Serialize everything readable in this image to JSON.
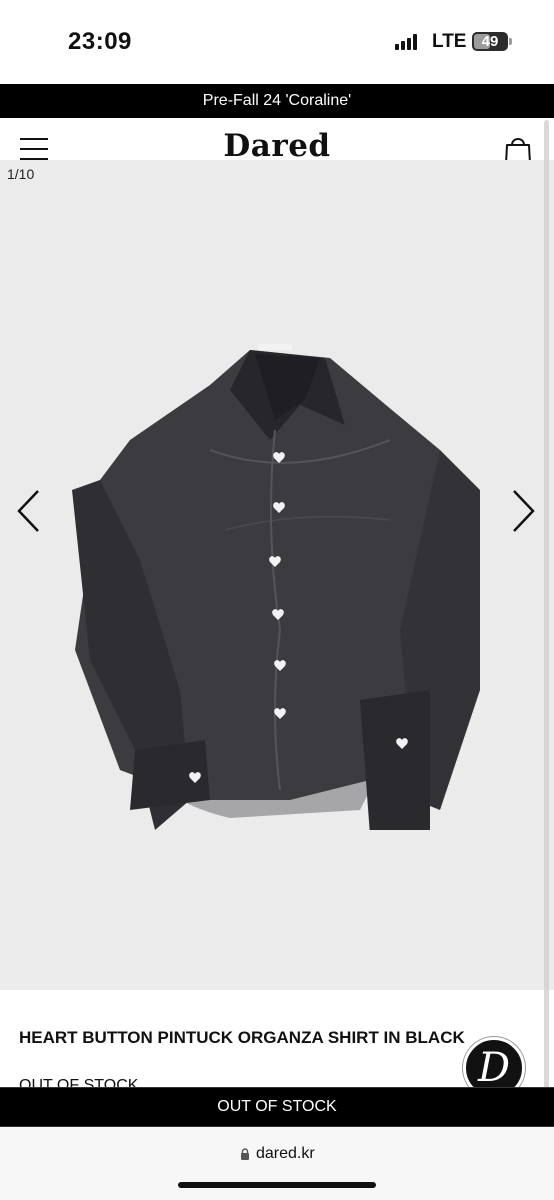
{
  "status_bar": {
    "time": "23:09",
    "network": "LTE",
    "battery": "49",
    "battery_level": 0.49
  },
  "announcement": "Pre-Fall 24 'Coraline'",
  "header": {
    "logo": "Dared"
  },
  "gallery": {
    "counter": "1/10"
  },
  "product": {
    "title": "HEART BUTTON PINTUCK ORGANZA SHIRT IN BLACK",
    "stock_status": "OUT OF STOCK"
  },
  "footer_button": "OUT OF STOCK",
  "brand_badge": "D",
  "browser": {
    "url": "dared.kr"
  },
  "colors": {
    "accent": "#000000",
    "gallery_bg": "#ebebeb"
  }
}
